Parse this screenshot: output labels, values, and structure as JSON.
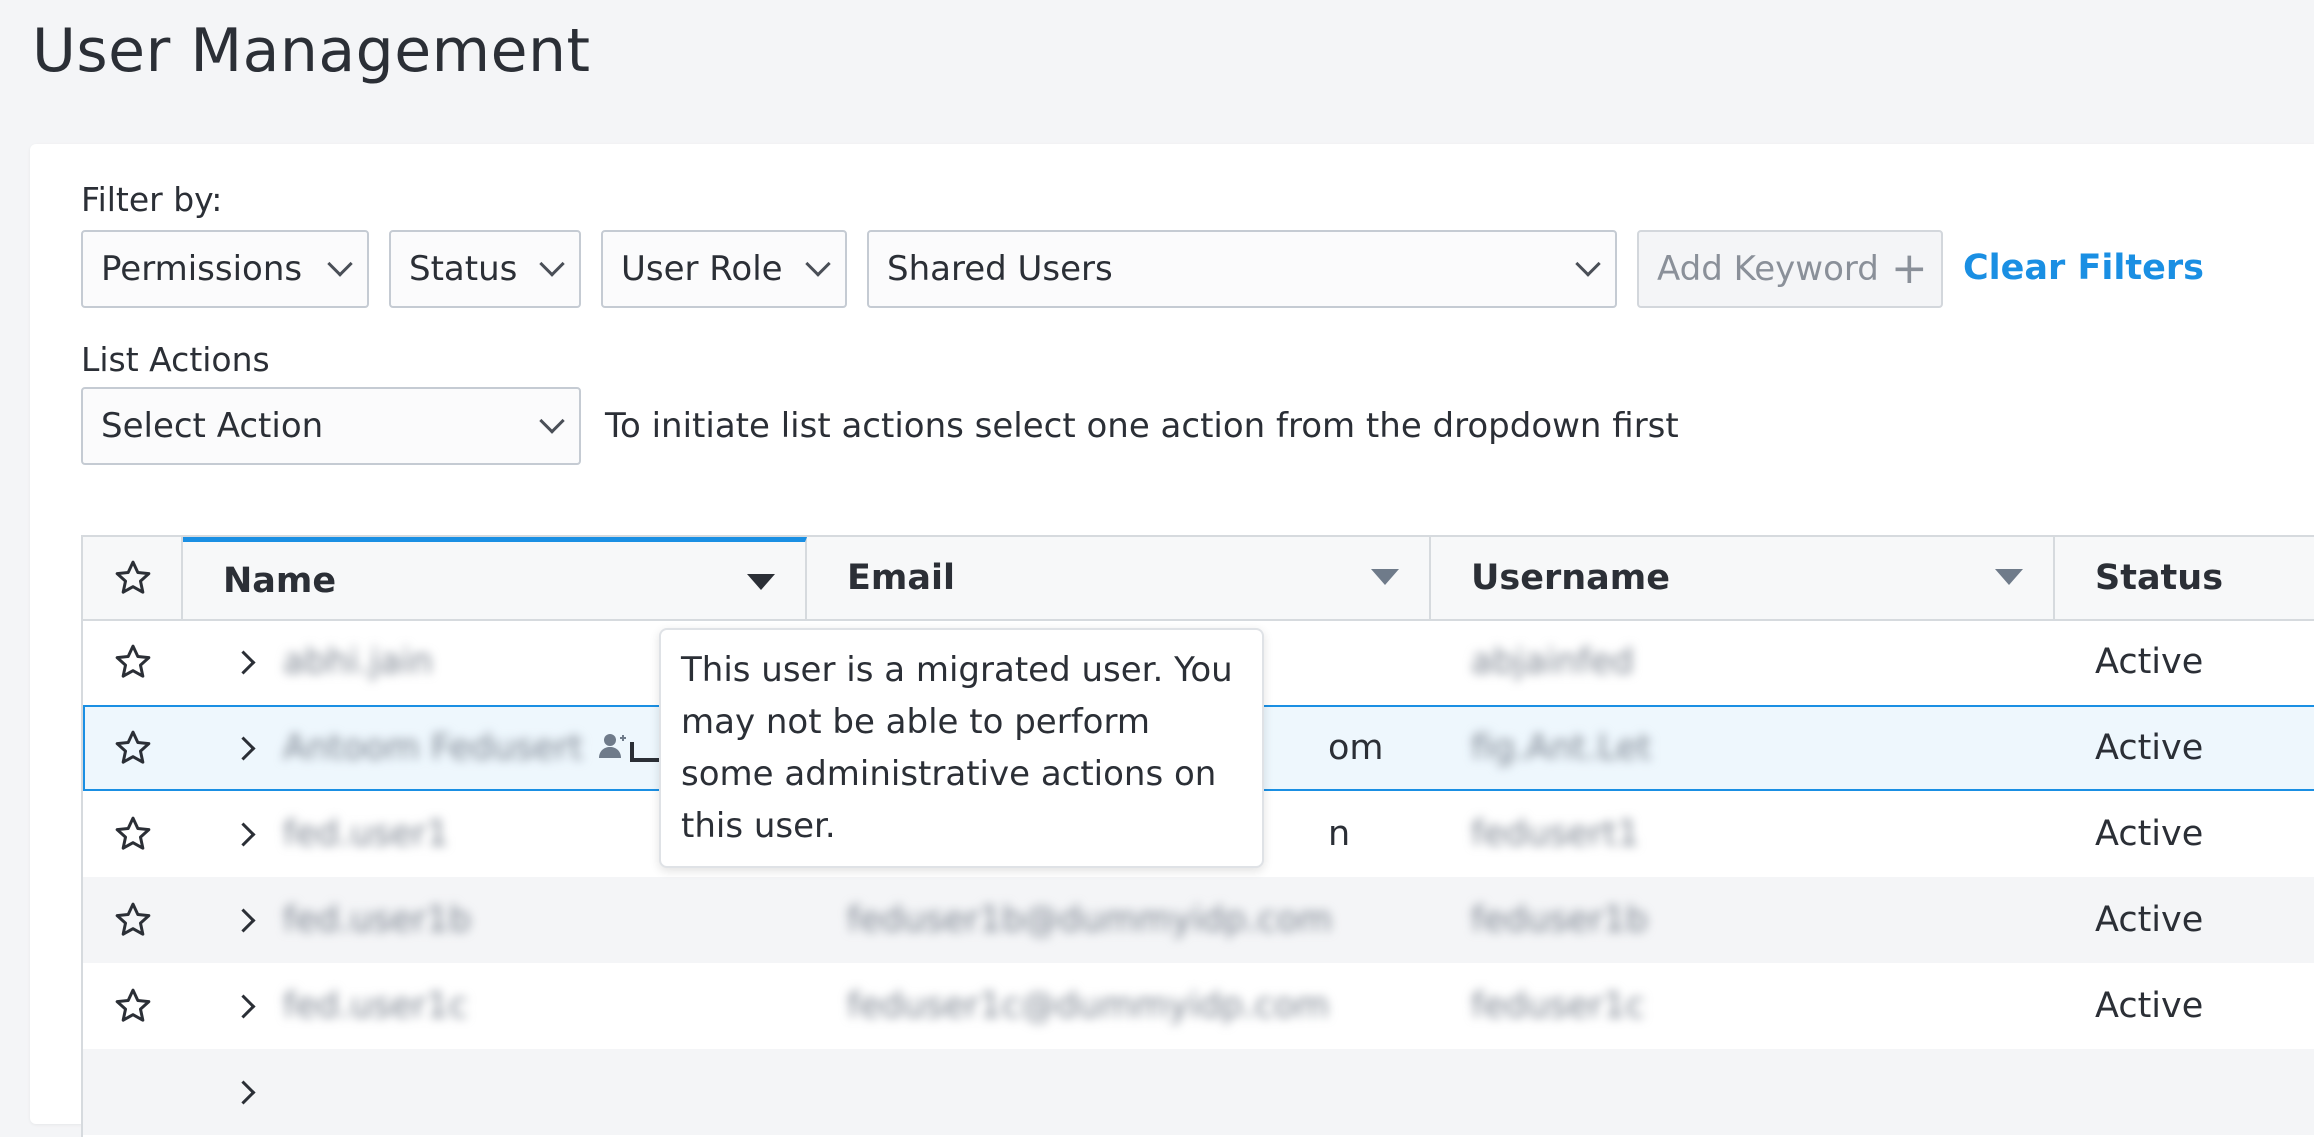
{
  "page": {
    "title": "User Management"
  },
  "filters": {
    "label": "Filter by:",
    "permissions": "Permissions",
    "status": "Status",
    "user_role": "User Role",
    "shared_users": "Shared Users",
    "add_keyword": "Add Keyword",
    "clear_filters": "Clear Filters"
  },
  "list_actions": {
    "label": "List Actions",
    "select": "Select Action",
    "hint": "To initiate list actions select one action from the dropdown first"
  },
  "table": {
    "columns": [
      "Name",
      "Email",
      "Username",
      "Status"
    ],
    "rows": [
      {
        "name": "abhi.jain",
        "email": "",
        "username": "abjainfed",
        "status": "Active"
      },
      {
        "name": "Antoom Fedusert",
        "email": "om",
        "username": "fig.Ant.Let",
        "status": "Active",
        "migrated": true
      },
      {
        "name": "fed.user1",
        "email": "n",
        "username": "fedusert1",
        "status": "Active"
      },
      {
        "name": "fed.user1b",
        "email": "feduser1b@dummyidp.com",
        "username": "feduser1b",
        "status": "Active"
      },
      {
        "name": "fed.user1c",
        "email": "feduser1c@dummyidp.com",
        "username": "feduser1c",
        "status": "Active"
      },
      {
        "name": "",
        "email": "",
        "username": "",
        "status": ""
      }
    ]
  },
  "tooltip": {
    "text": "This user is a migrated user. You may not be able to perform some administrative actions on this user."
  },
  "icons": {
    "star": "star-outline-icon",
    "expand": "chevron-right-icon",
    "migrated": "migrated-user-icon",
    "dropdown": "chevron-down-icon",
    "sort": "sort-descending-icon",
    "add": "plus-icon"
  },
  "colors": {
    "accent": "#1a8fe3",
    "selected_row": "#eef7fd"
  }
}
